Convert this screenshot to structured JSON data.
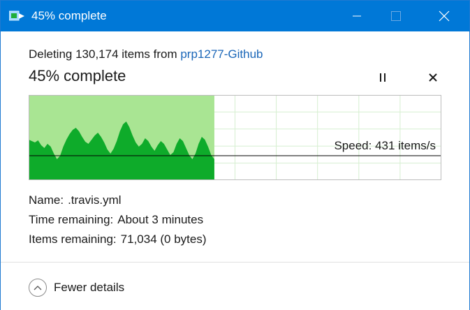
{
  "window": {
    "title": "45% complete",
    "controls": [
      "minimize-icon",
      "maximize-icon",
      "close-icon"
    ]
  },
  "operation": {
    "prefix": "Deleting 130,174 items from ",
    "source": "prp1277-Github",
    "headline": "45% complete",
    "progress_percent": 45,
    "speed_text": "Speed: 431 items/s"
  },
  "details": {
    "name_label": "Name:",
    "name_value": ".travis.yml",
    "time_label": "Time remaining:",
    "time_value": "About 3 minutes",
    "items_label": "Items remaining:",
    "items_value": "71,034 (0 bytes)"
  },
  "footer": {
    "fewer_details": "Fewer details"
  },
  "colors": {
    "accent": "#0078d7",
    "link": "#1a66b8",
    "progress_fill": "#a9e593",
    "speed_area": "#0eab2a",
    "grid": "#d6efd0"
  },
  "chart_data": {
    "type": "area",
    "progress_percent": 45,
    "current_speed": 431,
    "speed_unit": "items/s",
    "speed_samples": [
      58,
      56,
      54,
      57,
      50,
      46,
      52,
      48,
      38,
      30,
      35,
      48,
      58,
      66,
      72,
      75,
      70,
      62,
      55,
      52,
      58,
      64,
      68,
      62,
      54,
      44,
      38,
      45,
      56,
      70,
      80,
      84,
      76,
      64,
      54,
      48,
      52,
      60,
      56,
      48,
      42,
      50,
      56,
      52,
      44,
      36,
      40,
      52,
      60,
      56,
      46,
      36,
      30,
      38,
      52,
      62,
      58,
      48,
      36,
      30
    ]
  }
}
